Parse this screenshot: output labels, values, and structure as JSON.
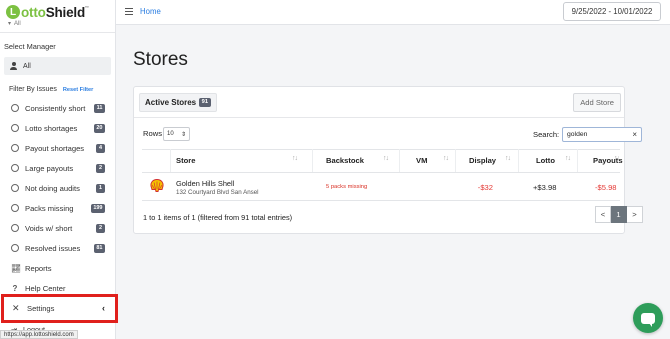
{
  "app": {
    "logo_letter": "L",
    "logo_text_green": "otto",
    "logo_text_dark": "Shield",
    "logo_tm": "™"
  },
  "sidebar": {
    "cut_item": "All",
    "manager_label": "Select Manager",
    "manager_value": "All",
    "filter_label": "Filter By Issues",
    "reset_label": "Reset Filter",
    "issues": [
      {
        "label": "Consistently short",
        "count": "11"
      },
      {
        "label": "Lotto shortages",
        "count": "20"
      },
      {
        "label": "Payout shortages",
        "count": "4"
      },
      {
        "label": "Large payouts",
        "count": "2"
      },
      {
        "label": "Not doing audits",
        "count": "1"
      },
      {
        "label": "Packs missing",
        "count": "199"
      },
      {
        "label": "Voids w/ short",
        "count": "2"
      },
      {
        "label": "Resolved issues",
        "count": "81"
      }
    ],
    "reports_label": "Reports",
    "help_label": "Help Center",
    "settings_label": "Settings",
    "logout_label": "Logout",
    "status_url": "https://app.lottoshield.com"
  },
  "topbar": {
    "home_label": "Home",
    "date_range": "9/25/2022 - 10/01/2022"
  },
  "main": {
    "title": "Stores",
    "active_tab_label": "Active Stores",
    "active_count": "91",
    "add_store_label": "Add Store",
    "rows_label": "Rows",
    "rows_value": "10",
    "search_label": "Search:",
    "search_value": "golden",
    "columns": [
      "Store",
      "Backstock",
      "VM",
      "Display",
      "Lotto",
      "Payouts"
    ],
    "rows": [
      {
        "store_name": "Golden Hills Shell",
        "store_address": "132 Courtyard Blvd San Ansel",
        "backstock": "5 packs missing",
        "vm": "",
        "display": "-$32",
        "lotto": "+$3.98",
        "payouts": "-$5.98"
      }
    ],
    "info": "1 to 1 items of 1 (filtered from 91 total entries)",
    "pager": {
      "prev": "<",
      "current": "1",
      "next": ">"
    }
  },
  "colors": {
    "brand_green": "#7cc142",
    "link_blue": "#2a7de1",
    "negative_red": "#e53935",
    "highlight_red": "#e0201c",
    "chat_green": "#2e9d5a"
  }
}
